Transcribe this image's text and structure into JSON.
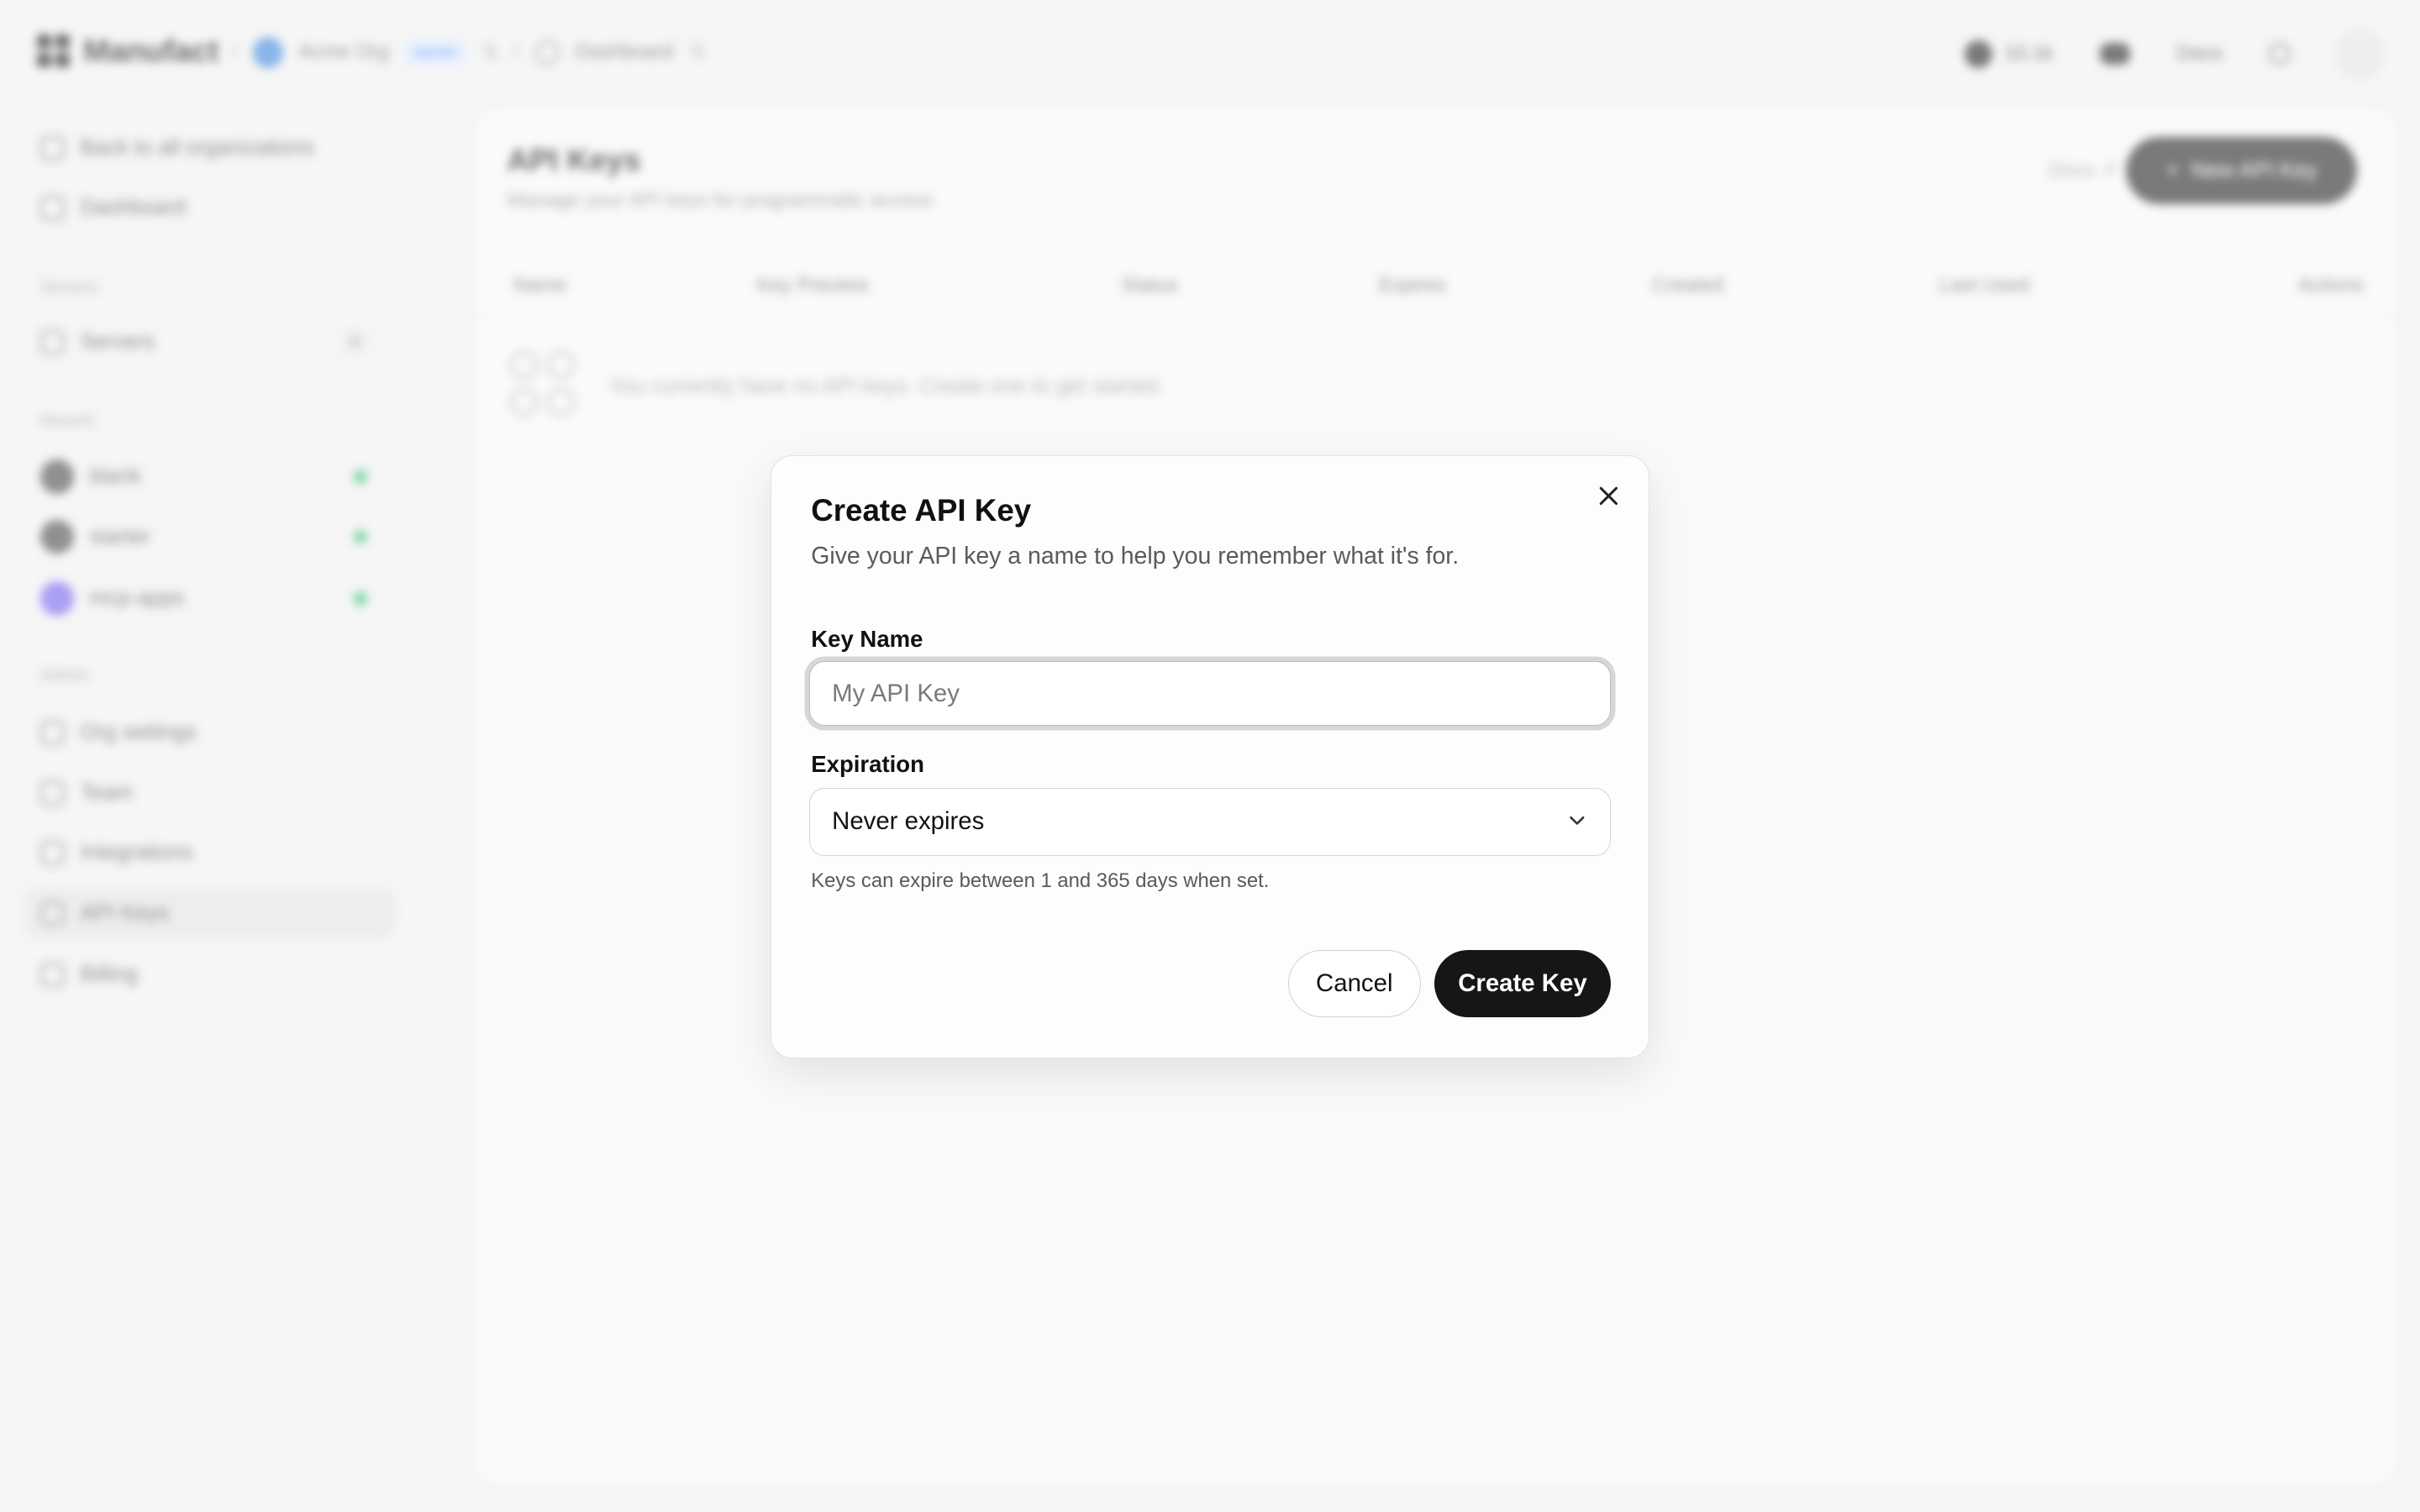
{
  "app": {
    "brand": "Manufact",
    "breadcrumb": {
      "org_name": "Acme Org",
      "org_plan": "starter",
      "page": "Dashboard"
    },
    "header": {
      "github_stars": "10.1k",
      "docs_label": "Docs"
    }
  },
  "sidebar": {
    "back_label": "Back to all organizations",
    "dashboard_label": "Dashboard",
    "servers_section": "Servers",
    "servers_label": "Servers",
    "servers_count": "4",
    "recent_section": "Recent",
    "recent": [
      {
        "label": "blank"
      },
      {
        "label": "starter"
      },
      {
        "label": "mcp-apps"
      }
    ],
    "admin_section": "Admin",
    "admin": [
      {
        "label": "Org settings"
      },
      {
        "label": "Team"
      },
      {
        "label": "Integrations"
      },
      {
        "label": "API Keys"
      },
      {
        "label": "Billing"
      }
    ]
  },
  "main": {
    "title": "API Keys",
    "subtitle": "Manage your API keys for programmatic access",
    "docs_label": "Docs",
    "new_button_label": "New API Key",
    "columns": [
      "Name",
      "Key Preview",
      "Status",
      "Expires",
      "Created",
      "Last Used",
      "Actions"
    ],
    "empty_text": "You currently have no API keys. Create one to get started."
  },
  "modal": {
    "title": "Create API Key",
    "description": "Give your API key a name to help you remember what it's for.",
    "name_label": "Key Name",
    "name_value": "",
    "name_placeholder": "My API Key",
    "expiration_label": "Expiration",
    "expiration_value": "Never expires",
    "hint": "Keys can expire between 1 and 365 days when set.",
    "cancel_label": "Cancel",
    "create_label": "Create Key"
  }
}
